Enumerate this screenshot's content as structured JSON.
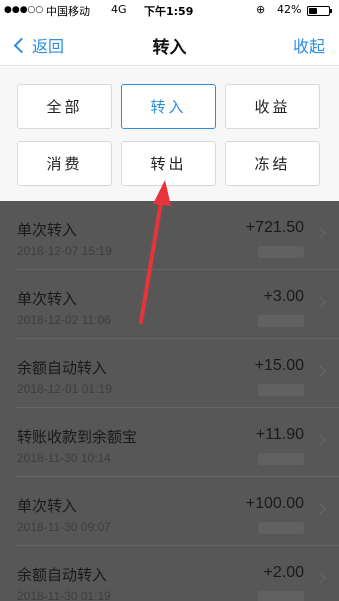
{
  "status_bar": {
    "signal_icon": "signal-dots-icon",
    "carrier": "中国移动",
    "network": "4G",
    "time": "下午1:59",
    "battery_percent": "42%",
    "battery_level": 0.42
  },
  "nav": {
    "back_label": "返回",
    "title": "转入",
    "collapse_label": "收起"
  },
  "filters": [
    {
      "label": "全部",
      "active": false
    },
    {
      "label": "转入",
      "active": true
    },
    {
      "label": "收益",
      "active": false
    },
    {
      "label": "消费",
      "active": false
    },
    {
      "label": "转出",
      "active": false
    },
    {
      "label": "冻结",
      "active": false
    }
  ],
  "transactions": [
    {
      "title": "单次转入",
      "date": "2018-12-07 15:19",
      "amount": "+721.50"
    },
    {
      "title": "单次转入",
      "date": "2018-12-02 11:06",
      "amount": "+3.00"
    },
    {
      "title": "余额自动转入",
      "date": "2018-12-01 01:19",
      "amount": "+15.00"
    },
    {
      "title": "转账收款到余额宝",
      "date": "2018-11-30 10:14",
      "amount": "+11.90"
    },
    {
      "title": "单次转入",
      "date": "2018-11-30 09:07",
      "amount": "+100.00"
    },
    {
      "title": "余额自动转入",
      "date": "2018-11-30 01:19",
      "amount": "+2.00"
    }
  ],
  "colors": {
    "accent": "#2b8ee0",
    "overlay": "#575757",
    "annotation_arrow": "#e8333a"
  }
}
